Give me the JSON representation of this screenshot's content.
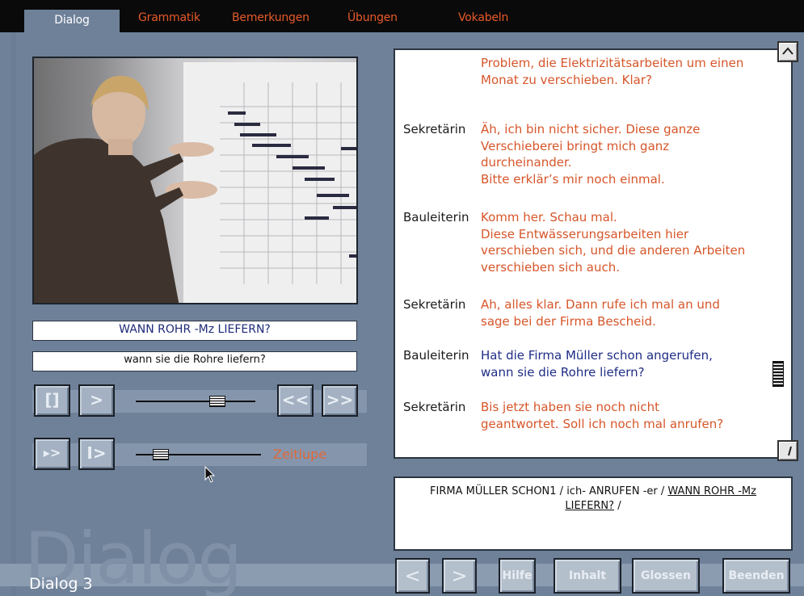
{
  "tabs": [
    {
      "label": "Dialog",
      "active": true
    },
    {
      "label": "Grammatik"
    },
    {
      "label": "Bemerkungen"
    },
    {
      "label": "Übungen"
    },
    {
      "label": "Vokabeln"
    }
  ],
  "video": {
    "description_icon": "video-frame"
  },
  "gloss_line": "WANN ROHR -Mz LIEFERN?",
  "translation_line": "wann sie die Rohre liefern?",
  "controls": {
    "row1": {
      "buttons": [
        "[]",
        ">",
        "<<",
        ">>"
      ],
      "slider_position": 0.68
    },
    "row2": {
      "buttons": [
        "▸>",
        "I>"
      ],
      "slider_position": 0.2,
      "label": "Zeitlupe"
    }
  },
  "dialogue": [
    {
      "speaker": "",
      "text": [
        "Problem, die Elektrizitätsarbeiten um einen",
        "Monat zu verschieben. Klar?"
      ],
      "color": "orange"
    },
    {
      "speaker": "Sekretärin",
      "text": [
        "Äh, ich bin nicht sicher. Diese ganze",
        "Verschieberei bringt mich ganz",
        "durcheinander.",
        "Bitte erklär’s mir noch einmal."
      ],
      "color": "orange"
    },
    {
      "speaker": "Bauleiterin",
      "text": [
        "Komm her. Schau mal.",
        "Diese Entwässerungsarbeiten hier",
        "verschieben sich, und die anderen Arbeiten",
        "verschieben sich auch."
      ],
      "color": "orange"
    },
    {
      "speaker": "Sekretärin",
      "text": [
        "Ah, alles klar. Dann rufe ich mal an und",
        "sage bei der Firma Bescheid."
      ],
      "color": "orange"
    },
    {
      "speaker": "Bauleiterin",
      "text": [
        "Hat die Firma Müller schon angerufen,",
        "wann sie die Rohre liefern?"
      ],
      "color": "blue"
    },
    {
      "speaker": "Sekretärin",
      "text": [
        "Bis jetzt haben sie noch nicht",
        "geantwortet. Soll  ich noch mal anrufen?"
      ],
      "color": "orange"
    }
  ],
  "notation": {
    "part1": "FIRMA MÜLLER SCHON1 / ich- ANRUFEN -er / ",
    "part2": "WANN ROHR -Mz",
    "part3": "LIEFERN?",
    "part4": " /"
  },
  "footer": {
    "watermark": "Dialog",
    "title": "Dialog 3",
    "buttons": [
      "<",
      ">",
      "Hilfe",
      "Inhalt",
      "Glossen",
      "Beenden"
    ]
  }
}
